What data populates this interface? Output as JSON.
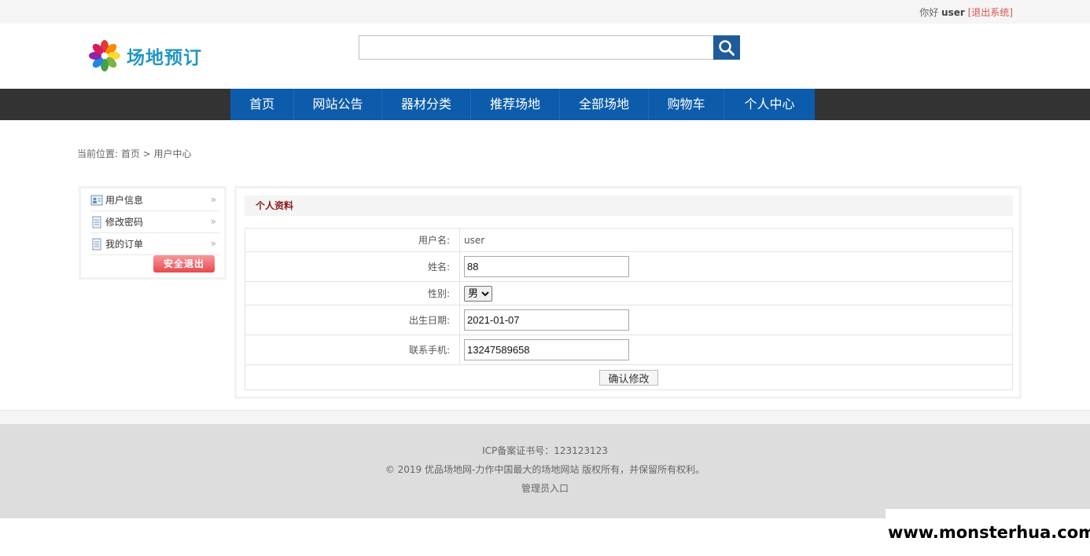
{
  "topbar": {
    "greeting": "你好",
    "username": "user",
    "logout": "[退出系统]"
  },
  "header": {
    "logo_text": "场地预订",
    "search_placeholder": ""
  },
  "nav": {
    "items": [
      "首页",
      "网站公告",
      "器材分类",
      "推荐场地",
      "全部场地",
      "购物车",
      "个人中心"
    ]
  },
  "breadcrumb": "当前位置: 首页 > 用户中心",
  "sidebar": {
    "items": [
      {
        "label": "用户信息",
        "icon": "user-card-icon"
      },
      {
        "label": "修改密码",
        "icon": "document-icon"
      },
      {
        "label": "我的订单",
        "icon": "document-icon"
      }
    ],
    "arrow": "»",
    "logout_button": "安全退出"
  },
  "profile": {
    "title": "个人资料",
    "username_label": "用户名:",
    "username_value": "user",
    "name_label": "姓名:",
    "name_value": "88",
    "gender_label": "性别:",
    "gender_value": "男",
    "birthday_label": "出生日期:",
    "birthday_value": "2021-01-07",
    "phone_label": "联系手机:",
    "phone_value": "13247589658",
    "submit_label": "确认修改"
  },
  "footer": {
    "icp": "ICP备案证书号：123123123",
    "copyright": "© 2019 优品场地网-力作中国最大的场地网站 版权所有，并保留所有权利。",
    "admin_link": "管理员入口"
  },
  "watermark": "www.monsterhua.com",
  "colors": {
    "nav_bg": "#0d5cab",
    "nav_bar": "#333333",
    "search_btn": "#1e5b9b",
    "logout": "#d9534f",
    "title": "#8b1a1a"
  }
}
